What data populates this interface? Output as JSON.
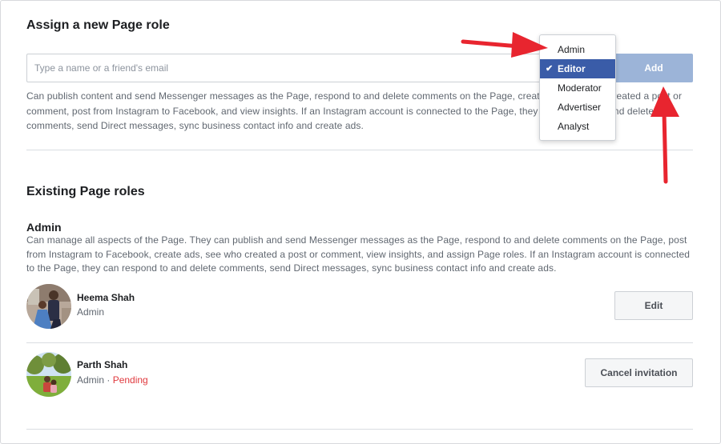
{
  "assign_section": {
    "title": "Assign a new Page role",
    "input_placeholder": "Type a name or a friend's email",
    "add_label": "Add",
    "role_description": "Can publish content and send Messenger messages as the Page, respond to and delete comments on the Page, create ads, see who created a post or comment, post from Instagram to Facebook, and view insights. If an Instagram account is connected to the Page, they can respond to and delete comments, send Direct messages, sync business contact info and create ads."
  },
  "role_dropdown": {
    "options": [
      "Admin",
      "Editor",
      "Moderator",
      "Advertiser",
      "Analyst"
    ],
    "selected": "Editor",
    "check_icon": "check-icon"
  },
  "existing_section": {
    "title": "Existing Page roles",
    "admin_heading": "Admin",
    "admin_description": "Can manage all aspects of the Page. They can publish and send Messenger messages as the Page, respond to and delete comments on the Page, post from Instagram to Facebook, create ads, see who created a post or comment, view insights, and assign Page roles. If an Instagram account is connected to the Page, they can respond to and delete comments, send Direct messages, sync business contact info and create ads.",
    "people": [
      {
        "name": "Heema Shah",
        "role": "Admin",
        "status": "",
        "action": "Edit"
      },
      {
        "name": "Parth Shah",
        "role": "Admin",
        "separator": " · ",
        "status": "Pending",
        "action": "Cancel invitation"
      }
    ]
  },
  "colors": {
    "add_button_bg": "#9cb4d8",
    "dropdown_selected_bg": "#3a5ca8",
    "pending_text": "#e0393e",
    "annotation_arrow": "#e8252f"
  }
}
